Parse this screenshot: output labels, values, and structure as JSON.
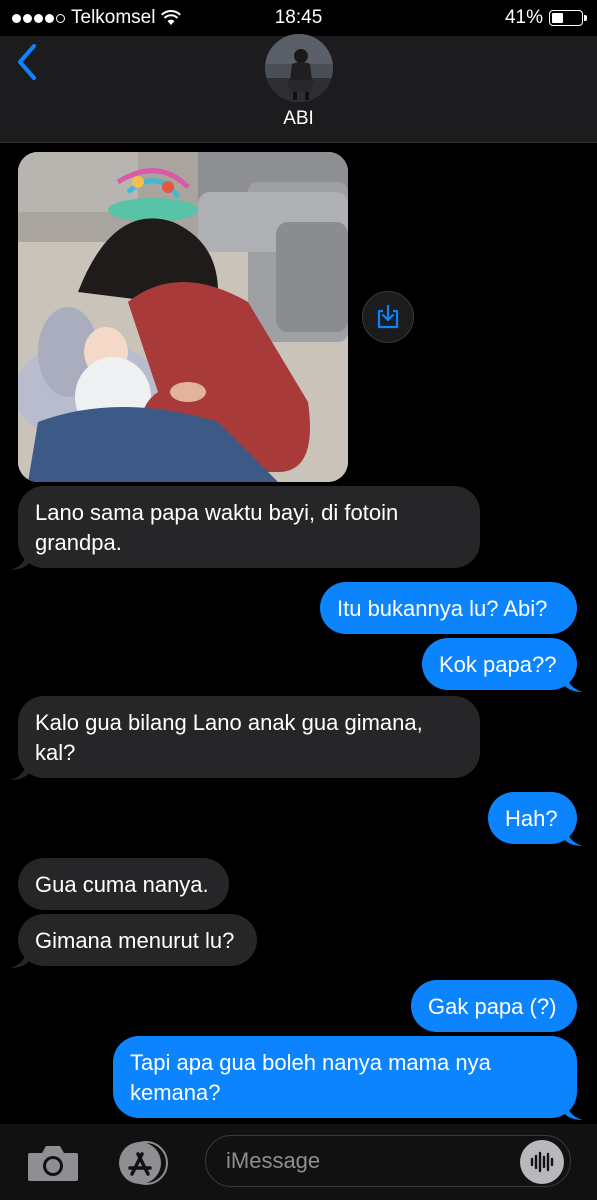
{
  "status_bar": {
    "carrier": "Telkomsel",
    "time": "18:45",
    "battery": "41%",
    "battery_level": 0.41,
    "signal_bars": 4,
    "icons": [
      "signal-dots-icon",
      "wifi-icon",
      "battery-icon"
    ]
  },
  "header": {
    "contact_name": "ABI",
    "icons": [
      "back-chevron-icon",
      "contact-avatar"
    ],
    "accent_color": "#0b84fe"
  },
  "messages": [
    {
      "from": "them",
      "type": "image",
      "icon": "save-download-icon"
    },
    {
      "from": "them",
      "text": "Lano sama papa waktu bayi, di fotoin grandpa."
    },
    {
      "from": "me",
      "text": "Itu bukannya lu? Abi?"
    },
    {
      "from": "me",
      "text": "Kok papa??"
    },
    {
      "from": "them",
      "text": "Kalo gua bilang Lano anak gua gimana, kal?"
    },
    {
      "from": "me",
      "text": "Hah?"
    },
    {
      "from": "them",
      "text": "Gua cuma nanya."
    },
    {
      "from": "them",
      "text": "Gimana menurut lu?"
    },
    {
      "from": "me",
      "text": "Gak papa (?)"
    },
    {
      "from": "me",
      "text": "Tapi apa gua boleh nanya mama nya kemana?"
    }
  ],
  "composer": {
    "placeholder": "iMessage",
    "icons": [
      "camera-icon",
      "app-store-icon",
      "audio-waveform-icon"
    ]
  },
  "colors": {
    "incoming_bubble": "#262628",
    "outgoing_bubble": "#0b84fe",
    "background": "#000000"
  }
}
